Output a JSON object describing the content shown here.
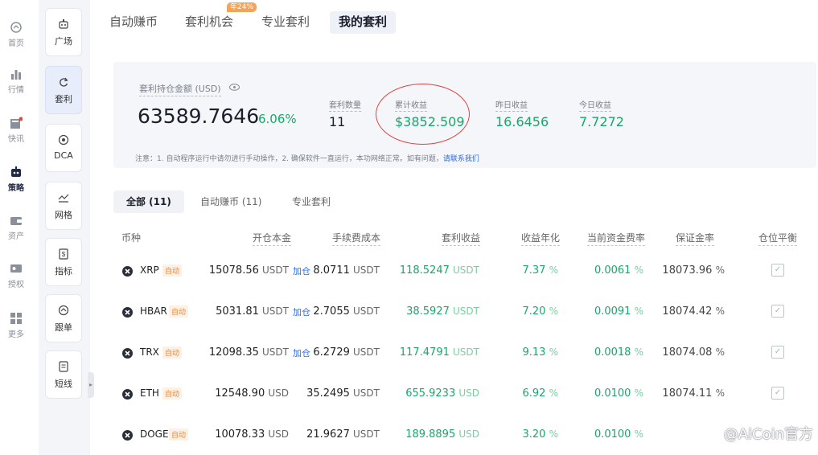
{
  "rail": [
    {
      "label": "首页",
      "icon": "home-icon"
    },
    {
      "label": "行情",
      "icon": "chart-bars-icon"
    },
    {
      "label": "快讯",
      "icon": "news-icon"
    },
    {
      "label": "策略",
      "icon": "robot-icon",
      "active": true
    },
    {
      "label": "资产",
      "icon": "wallet-icon"
    },
    {
      "label": "授权",
      "icon": "key-icon"
    },
    {
      "label": "更多",
      "icon": "grid-icon"
    }
  ],
  "subnav": [
    {
      "label": "广场",
      "icon": "robot-small-icon"
    },
    {
      "label": "套利",
      "icon": "refresh-icon",
      "active": true
    },
    {
      "label": "DCA",
      "icon": "coin-icon"
    },
    {
      "label": "网格",
      "icon": "grid-chart-icon"
    },
    {
      "label": "指标",
      "icon": "dollar-doc-icon"
    },
    {
      "label": "跟单",
      "icon": "follow-icon"
    },
    {
      "label": "短线",
      "icon": "note-icon"
    }
  ],
  "tabs": [
    "自动赚币",
    "套利机会",
    "专业套利",
    "我的套利"
  ],
  "tab_badge": "年24%",
  "summary": {
    "label": "套利持仓金额 (USD)",
    "value": "63589.7646",
    "pct": "6.06%",
    "stats": [
      {
        "label": "套利数量",
        "value": "11"
      },
      {
        "label": "累计收益",
        "value": "$3852.509"
      },
      {
        "label": "昨日收益",
        "value": "16.6456"
      },
      {
        "label": "今日收益",
        "value": "7.7272"
      }
    ],
    "notice": "注意：1. 自动程序运行中请勿进行手动操作，2. 确保软件一直运行，本功网络正常。如有问题，",
    "notice_link": "请联系我们"
  },
  "filters": [
    "全部 (11)",
    "自动赚币 (11)",
    "专业套利"
  ],
  "columns": [
    "币种",
    "开仓本金",
    "手续费成本",
    "套利收益",
    "收益年化",
    "当前资金费率",
    "保证金率",
    "仓位平衡"
  ],
  "auto_label": "自动",
  "add_label": "加仓",
  "rows": [
    {
      "coin": "XRP",
      "principal": "15078.56",
      "p_unit": "USDT",
      "add": true,
      "fee": "8.0711",
      "fee_unit": "USDT",
      "profit": "118.5247",
      "profit_unit": "USDT",
      "apr": "7.37",
      "apr_unit": "%",
      "rate": "0.0061",
      "rate_unit": "%",
      "margin": "18073.96",
      "margin_unit": "%",
      "balanced": true
    },
    {
      "coin": "HBAR",
      "principal": "5031.81",
      "p_unit": "USDT",
      "add": true,
      "fee": "2.7055",
      "fee_unit": "USDT",
      "profit": "38.5927",
      "profit_unit": "USDT",
      "apr": "7.20",
      "apr_unit": "%",
      "rate": "0.0091",
      "rate_unit": "%",
      "margin": "18074.42",
      "margin_unit": "%",
      "balanced": true
    },
    {
      "coin": "TRX",
      "principal": "12098.35",
      "p_unit": "USDT",
      "add": true,
      "fee": "6.2729",
      "fee_unit": "USDT",
      "profit": "117.4791",
      "profit_unit": "USDT",
      "apr": "9.13",
      "apr_unit": "%",
      "rate": "0.0018",
      "rate_unit": "%",
      "margin": "18074.08",
      "margin_unit": "%",
      "balanced": true
    },
    {
      "coin": "ETH",
      "principal": "12548.90",
      "p_unit": "USD",
      "add": false,
      "fee": "35.2495",
      "fee_unit": "USDT",
      "profit": "655.9233",
      "profit_unit": "USD",
      "apr": "6.92",
      "apr_unit": "%",
      "rate": "0.0100",
      "rate_unit": "%",
      "margin": "18074.11",
      "margin_unit": "%",
      "balanced": true
    },
    {
      "coin": "DOGE",
      "principal": "10078.33",
      "p_unit": "USD",
      "add": false,
      "fee": "21.9627",
      "fee_unit": "USDT",
      "profit": "189.8895",
      "profit_unit": "USD",
      "apr": "3.20",
      "apr_unit": "%",
      "rate": "0.0100",
      "rate_unit": "%",
      "margin": "",
      "margin_unit": "",
      "balanced": false
    }
  ],
  "watermark": "@AiCoin官方",
  "colors": {
    "green": "#1aa66a",
    "accent_blue": "#2f6bdb",
    "highlight_red": "#d94545",
    "badge_orange": "#f3a35a"
  }
}
